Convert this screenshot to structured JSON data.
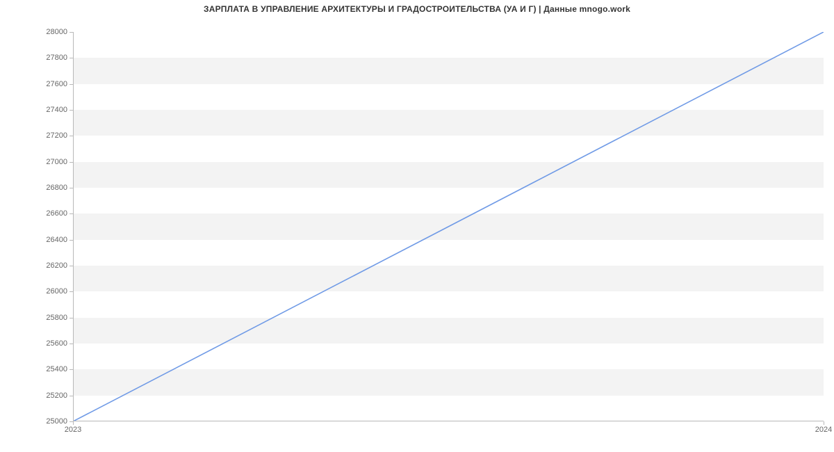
{
  "chart_data": {
    "type": "line",
    "title": "ЗАРПЛАТА В УПРАВЛЕНИЕ АРХИТЕКТУРЫ И ГРАДОСТРОИТЕЛЬСТВА (УА И Г) | Данные mnogo.work",
    "xlabel": "",
    "ylabel": "",
    "x": [
      2023,
      2024
    ],
    "values": [
      25000,
      28000
    ],
    "y_ticks": [
      25000,
      25200,
      25400,
      25600,
      25800,
      26000,
      26200,
      26400,
      26600,
      26800,
      27000,
      27200,
      27400,
      27600,
      27800,
      28000
    ],
    "x_ticks": [
      2023,
      2024
    ],
    "ylim": [
      25000,
      28000
    ],
    "xlim": [
      2023,
      2024
    ],
    "line_color": "#6f9ae6",
    "stripe_color": "#f3f3f3"
  }
}
